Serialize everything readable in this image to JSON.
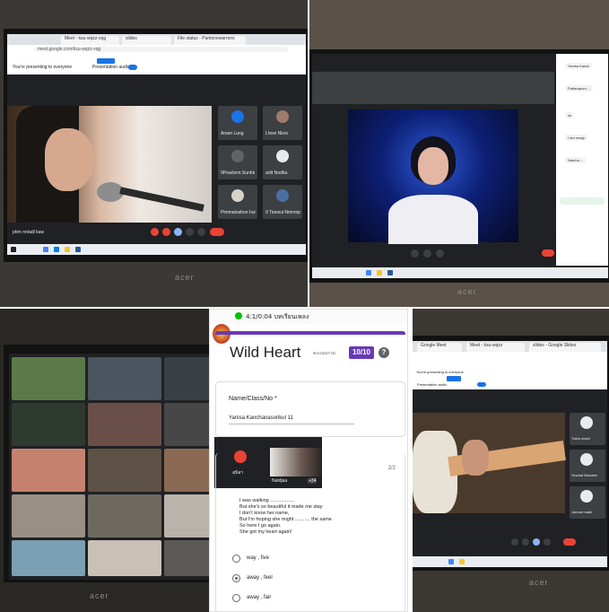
{
  "top_left": {
    "presenting_text": "You're presenting to everyone",
    "presentation_audio": "Presentation audio",
    "tabs": [
      "Meet - ksu-wqzz-vqg",
      "slides",
      "File status - Pantonewarrens"
    ],
    "url": "meet.google.com/ksu-wqzz-vqg",
    "participants": [
      "Anam Lung",
      "Lhoei Nkns",
      "9Pearlsnn Sunhk",
      "Pimmatsahon hui",
      "arltt Nndbu",
      "9 Tiansui Nmnmp"
    ],
    "bottom_name": "phm nntadl kaw",
    "laptop_brand": "acer"
  },
  "top_right": {
    "laptop_brand": "acer",
    "chat_snippets": [
      "Yanisa Kanch",
      "Pattaraporn ...",
      "ok",
      "I am ready",
      "Natcha ..."
    ]
  },
  "bottom_left": {
    "laptop_brand": "acer"
  },
  "form": {
    "status_bar": "4:1/0:04 บทเรียนเพลง",
    "title": "Wild Heart",
    "score_label": "คะแนนรวม",
    "score": "10/10",
    "help_icon": "?",
    "question_label": "Name/Class/No *",
    "answer": "Yanisa Kanchanasorikul 11",
    "page_indicator": "2/2",
    "video_names": [
      "สุนิสา",
      "Natdjaa"
    ],
    "video_badge": "+34",
    "lyrics": [
      "I was walking ..................",
      "But she's so beautiful it made me stay",
      "I don't know her name,",
      "But I'm hoping she might ........... the same",
      "So here I go again.",
      "She got my heart again!"
    ],
    "options": [
      "way , five",
      "away , feel",
      "away , fair"
    ],
    "selected_option": 1
  },
  "bottom_right": {
    "tabs": [
      "Google Meet",
      "Meet - ksu-wqzz",
      "slides - Google Slides"
    ],
    "presenting_text": "You're presenting to everyone",
    "presentation_audio": "Presentation audio",
    "participants": [
      "Tukta ubahi",
      "Sinchai Bubalee",
      "Jarerat maiki"
    ],
    "laptop_brand": "acer"
  },
  "colors": {
    "meet_dark": "#202124",
    "tile": "#3c4043",
    "form_purple": "#673ab7",
    "end_call": "#ea4335",
    "blue": "#1a73e8"
  }
}
